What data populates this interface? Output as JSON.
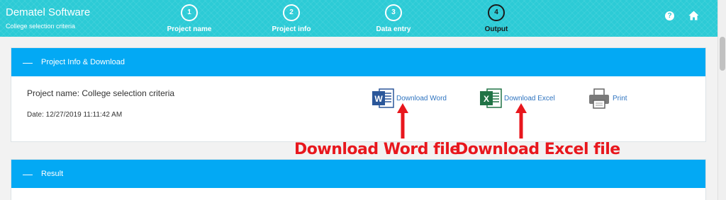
{
  "header": {
    "title": "Dematel Software",
    "subtitle": "College selection criteria",
    "steps": [
      {
        "num": "1",
        "label": "Project name"
      },
      {
        "num": "2",
        "label": "Project info"
      },
      {
        "num": "3",
        "label": "Data entry"
      },
      {
        "num": "4",
        "label": "Output"
      }
    ],
    "active_step": 4,
    "help_symbol": "?",
    "icons": {
      "help": "help-icon",
      "home": "home-icon"
    }
  },
  "panel_info": {
    "toggle": "—",
    "title": "Project Info & Download",
    "project_name": "Project name: College selection criteria",
    "date": "Date: 12/27/2019 11:11:42 AM",
    "downloads": [
      {
        "label": "Download Word",
        "icon": "word-icon"
      },
      {
        "label": "Download Excel",
        "icon": "excel-icon"
      },
      {
        "label": "Print",
        "icon": "printer-icon"
      }
    ]
  },
  "panel_result": {
    "toggle": "—",
    "title": "Result"
  },
  "annotations": {
    "word": "Download Word file",
    "excel": "Download Excel file"
  },
  "colors": {
    "header": "#2ccbd6",
    "panel_head": "#03a9f4",
    "link": "#2f74c0",
    "annotation": "#e8171d",
    "word_blue": "#2b579a",
    "excel_green": "#217346"
  }
}
